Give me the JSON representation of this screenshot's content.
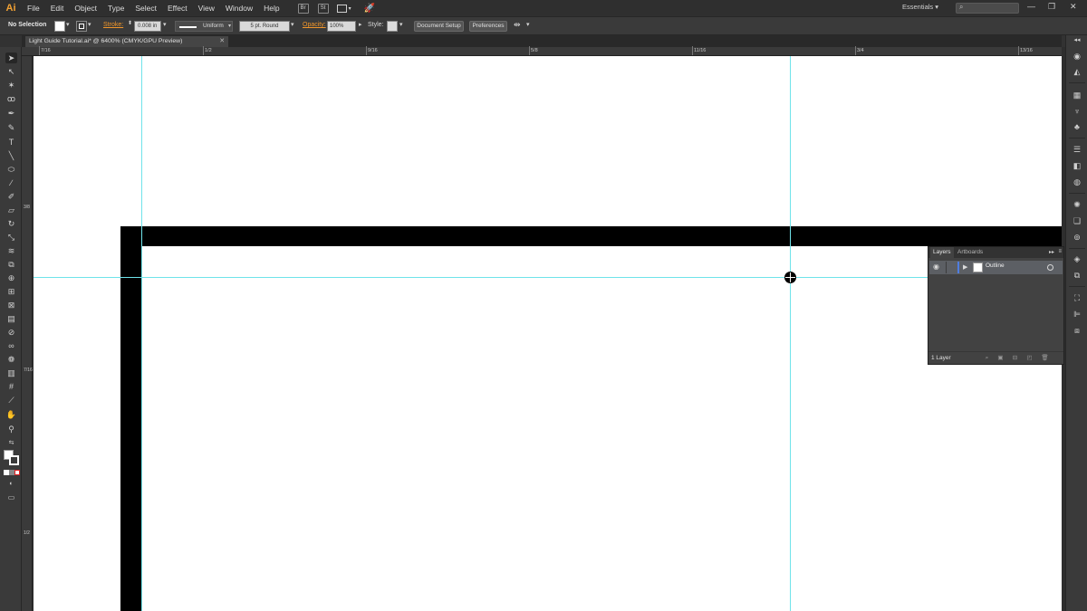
{
  "app": {
    "logo": "Ai"
  },
  "menu": [
    "File",
    "Edit",
    "Object",
    "Type",
    "Select",
    "Effect",
    "View",
    "Window",
    "Help"
  ],
  "menu_badges": [
    "Br",
    "St"
  ],
  "workspace": {
    "label": "Essentials",
    "arrow": "▾"
  },
  "search": {
    "icon": "⌕"
  },
  "window_controls": {
    "minimize": "—",
    "maximize": "❐",
    "close": "✕"
  },
  "controlbar": {
    "selection": "No Selection",
    "stroke_label": "Stroke:",
    "stroke_weight": "0.008 in",
    "profile": "Uniform",
    "brush": "5 pt. Round",
    "opacity_label": "Opacity:",
    "opacity_value": "100%",
    "style_label": "Style:",
    "doc_setup": "Document Setup",
    "preferences": "Preferences"
  },
  "document_tab": {
    "title": "Light Guide Tutorial.ai* @ 6400% (CMYK/GPU Preview)",
    "close": "✕"
  },
  "ruler_top": {
    "labels": [
      "7/16",
      "1/2",
      "9/16",
      "5/8",
      "11/16",
      "3/4",
      "13/16"
    ]
  },
  "ruler_left": {
    "labels": [
      "3/8",
      "7/16",
      "1/2"
    ]
  },
  "layers_panel": {
    "tabs": [
      "Layers",
      "Artboards"
    ],
    "collapse": "▸▸",
    "menu": "≡",
    "layer_name": "Outline",
    "count": "1 Layer"
  },
  "colors": {
    "accent": "#f0962a",
    "guide": "#6fe3ea",
    "layer_color": "#4f7de0",
    "canvas": "#ffffff"
  }
}
